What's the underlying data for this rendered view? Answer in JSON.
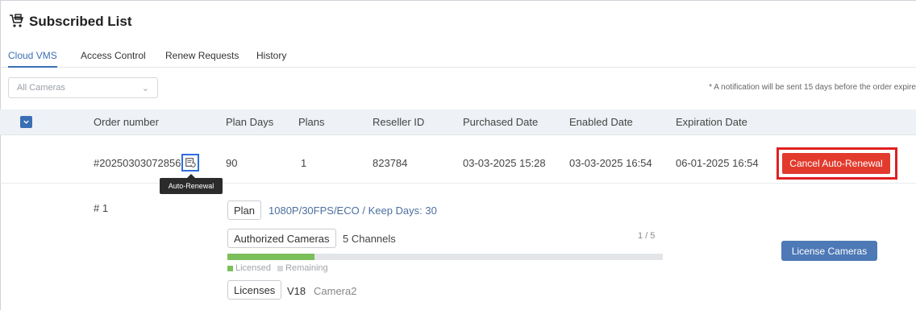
{
  "page": {
    "title": "Subscribed List"
  },
  "tabs": [
    {
      "label": "Cloud VMS",
      "active": true
    },
    {
      "label": "Access Control",
      "active": false
    },
    {
      "label": "Renew Requests",
      "active": false
    },
    {
      "label": "History",
      "active": false
    }
  ],
  "filter": {
    "selected": "All Cameras"
  },
  "notice": "* A notification will be sent 15 days before the order expire",
  "table": {
    "headers": {
      "order_number": "Order number",
      "plan_days": "Plan Days",
      "plans": "Plans",
      "reseller_id": "Reseller ID",
      "purchased_date": "Purchased Date",
      "enabled_date": "Enabled Date",
      "expiration_date": "Expiration Date"
    },
    "row": {
      "order_number": "#20250303072856",
      "plan_days": "90",
      "plans": "1",
      "reseller_id": "823784",
      "purchased_date": "03-03-2025 15:28",
      "enabled_date": "03-03-2025 16:54",
      "expiration_date": "06-01-2025 16:54",
      "tooltip": "Auto-Renewal",
      "cancel_label": "Cancel Auto-Renewal"
    }
  },
  "detail": {
    "index": "# 1",
    "plan_label": "Plan",
    "plan_value": "1080P/30FPS/ECO / Keep Days: 30",
    "authorized_label": "Authorized Cameras",
    "authorized_value": "5 Channels",
    "ratio": "1 / 5",
    "progress_fraction": 0.2,
    "legend_licensed": "Licensed",
    "legend_remaining": "Remaining",
    "licenses_label": "Licenses",
    "license_item_name": "V18",
    "license_item_camera": "Camera2",
    "license_cameras_button": "License Cameras"
  },
  "colors": {
    "accent": "#3a6fb5",
    "danger": "#e23b2e",
    "licensed": "#7bbf5a",
    "remaining": "#e3e5e8",
    "link": "#4d6fa0"
  }
}
